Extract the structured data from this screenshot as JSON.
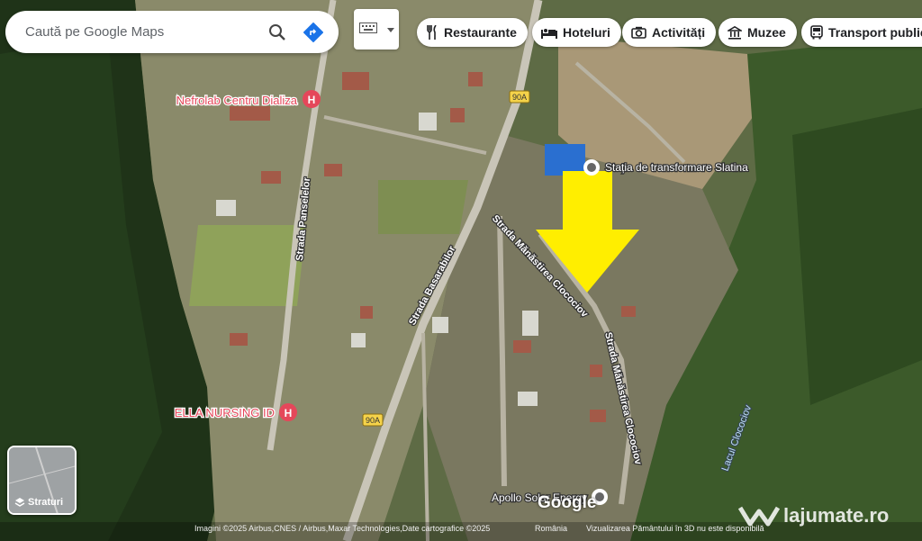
{
  "search": {
    "placeholder": "Caută pe Google Maps"
  },
  "chips": [
    {
      "label": "Restaurante",
      "icon": "fork-knife-icon"
    },
    {
      "label": "Hoteluri",
      "icon": "bed-icon"
    },
    {
      "label": "Activități",
      "icon": "camera-icon"
    },
    {
      "label": "Muzee",
      "icon": "museum-icon"
    },
    {
      "label": "Transport public",
      "icon": "bus-icon"
    }
  ],
  "map": {
    "streets": [
      "Strada Panselelor",
      "Strada Basarabilor",
      "Strada Mănăstirea Clocociov",
      "Strada Mănăstirea Clocociov"
    ],
    "road_shields": [
      "90A",
      "90A"
    ],
    "places": [
      "Nefrolab Centru Dializa",
      "ELLA NURSING ID",
      "Stația de transformare Slatina",
      "Apollo Solar Energy"
    ],
    "lake": "Lacul Clocociov",
    "arrow_color": "#ffee00"
  },
  "layers": {
    "label": "Straturi"
  },
  "attribution": {
    "imagery": "Imagini ©2025 Airbus,CNES / Airbus,Maxar Technologies,Date cartografice ©2025",
    "country": "România",
    "note": "Vizualizarea Pământului în 3D nu este disponibilă"
  },
  "logo": "Google",
  "watermark": "lajumate.ro"
}
